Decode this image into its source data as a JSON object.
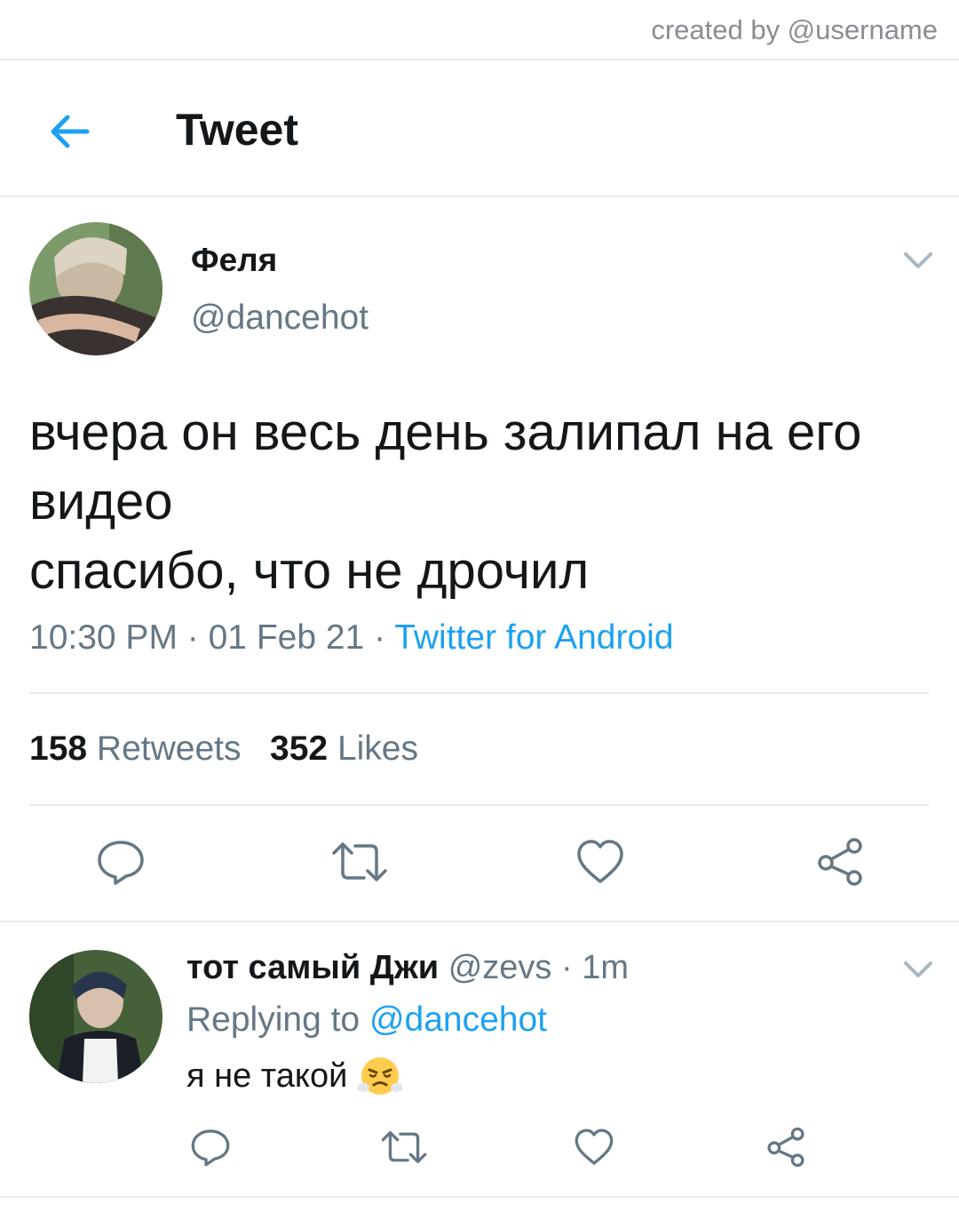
{
  "watermark": "created by @username",
  "header": {
    "title": "Tweet"
  },
  "tweet": {
    "author_name": "Феля",
    "author_handle": "@dancehot",
    "text": "вчера он весь день залипал на его\nвидео\nспасибо, что не дрочил",
    "time": "10:30 PM",
    "date": "01 Feb 21",
    "source": "Twitter for Android",
    "separator": " · ",
    "retweets_count": "158",
    "retweets_label": "Retweets",
    "likes_count": "352",
    "likes_label": "Likes"
  },
  "reply": {
    "author_name": "тот самый Джи",
    "author_handle": "@zevs",
    "time_ago": "1m",
    "separator": " · ",
    "replying_prefix": "Replying to ",
    "replying_to": "@dancehot",
    "text": "я не такой",
    "emoji": "face-with-steam-from-nose"
  },
  "colors": {
    "accent": "#1da1f2",
    "secondary_text": "#657786",
    "divider": "#e6ecf0"
  },
  "icons": [
    "back-arrow-icon",
    "chevron-down-icon",
    "reply-icon",
    "retweet-icon",
    "like-icon",
    "share-icon"
  ]
}
